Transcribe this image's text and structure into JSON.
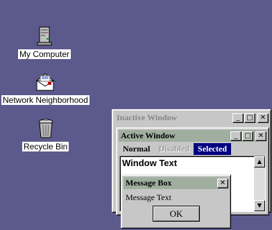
{
  "desktop": {
    "background_color": "#5c5a8c",
    "icons": [
      {
        "label": "My Computer",
        "icon": "computer-icon"
      },
      {
        "label": "Network Neighborhood",
        "icon": "network-icon"
      },
      {
        "label": "Recycle Bin",
        "icon": "recycle-bin-icon"
      }
    ]
  },
  "inactive_window": {
    "title": "Inactive Window",
    "buttons": {
      "minimize": "_",
      "maximize": "□",
      "close": "✕"
    }
  },
  "active_window": {
    "title": "Active Window",
    "buttons": {
      "minimize": "_",
      "maximize": "□",
      "close": "✕"
    },
    "menu": {
      "normal": "Normal",
      "disabled": "Disabled",
      "selected": "Selected"
    },
    "client_text": "Window Text",
    "scroll_up": "▲",
    "scroll_down": "▼"
  },
  "message_box": {
    "title": "Message Box",
    "close": "✕",
    "text": "Message Text",
    "ok_label": "OK"
  },
  "colors": {
    "active_title": "#9fae9f",
    "inactive_title": "#c7c7c7",
    "selection": "#000080",
    "face": "#c7c7c7"
  }
}
